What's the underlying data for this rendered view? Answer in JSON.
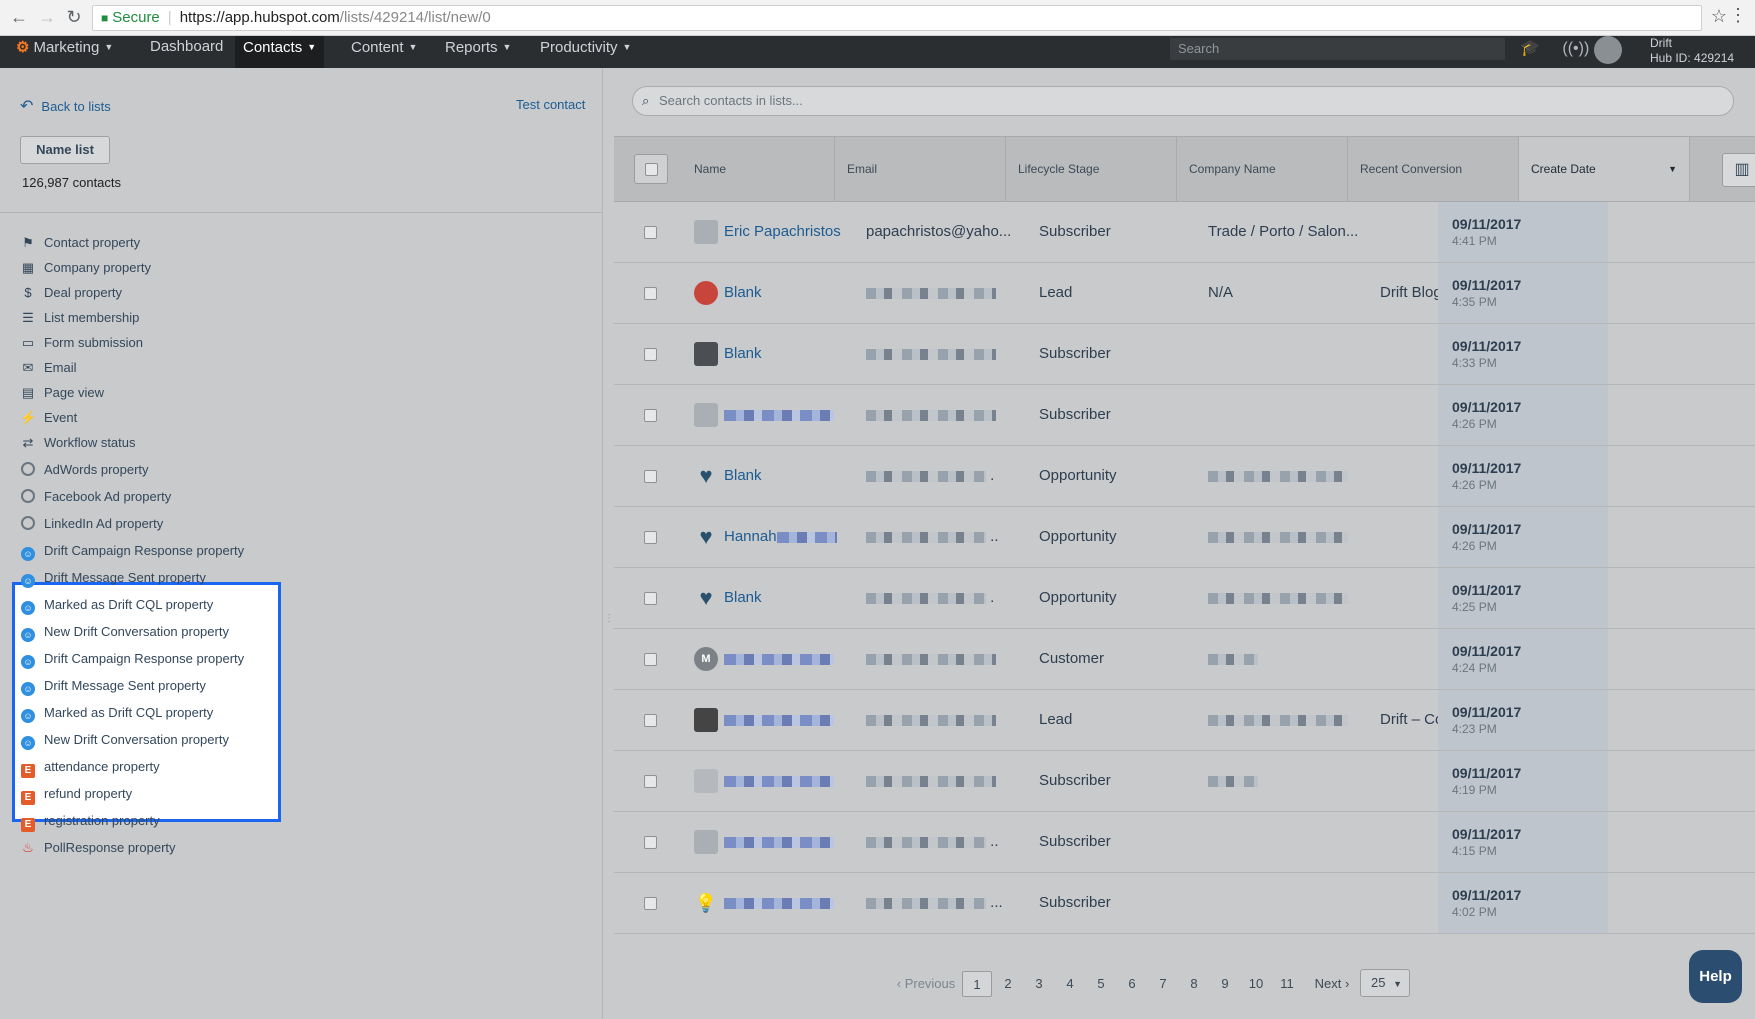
{
  "browser": {
    "back_icon": "←",
    "forward_icon": "→",
    "reload_icon": "↻",
    "secure_label": "Secure",
    "url_host": "https://app.hubspot.com",
    "url_path": "/lists/429214/list/new/0",
    "star_icon": "☆",
    "menu_icon": "⋮"
  },
  "nav": {
    "marketing": "Marketing",
    "dashboard": "Dashboard",
    "contacts": "Contacts",
    "content": "Content",
    "reports": "Reports",
    "productivity": "Productivity",
    "search_placeholder": "Search",
    "account_name": "Drift",
    "hub_id": "Hub ID: 429214"
  },
  "left": {
    "back_label": "Back to lists",
    "test_contact": "Test contact",
    "name_list_button": "Name list",
    "contacts_count": "126,987 contacts",
    "filters": [
      {
        "icon": "flag-icon",
        "glyph": "⚑",
        "label": "Contact property"
      },
      {
        "icon": "building-icon",
        "glyph": "▦",
        "label": "Company property"
      },
      {
        "icon": "dollar-icon",
        "glyph": "$",
        "label": "Deal property"
      },
      {
        "icon": "list-icon",
        "glyph": "☰",
        "label": "List membership"
      },
      {
        "icon": "form-icon",
        "glyph": "▭",
        "label": "Form submission"
      },
      {
        "icon": "envelope-icon",
        "glyph": "✉",
        "label": "Email"
      },
      {
        "icon": "page-icon",
        "glyph": "▤",
        "label": "Page view"
      },
      {
        "icon": "bolt-icon",
        "glyph": "⚡",
        "label": "Event"
      },
      {
        "icon": "shuffle-icon",
        "glyph": "⇄",
        "label": "Workflow status"
      },
      {
        "icon": "target-icon",
        "glyph": "",
        "label": "AdWords property"
      },
      {
        "icon": "target-icon",
        "glyph": "",
        "label": "Facebook Ad property"
      },
      {
        "icon": "target-icon",
        "glyph": "",
        "label": "LinkedIn Ad property"
      },
      {
        "icon": "drift-icon",
        "glyph": "☺",
        "label": "Drift Campaign Response property"
      },
      {
        "icon": "drift-icon",
        "glyph": "☺",
        "label": "Drift Message Sent property"
      },
      {
        "icon": "drift-icon",
        "glyph": "☺",
        "label": "Marked as Drift CQL property"
      },
      {
        "icon": "drift-icon",
        "glyph": "☺",
        "label": "New Drift Conversation property"
      },
      {
        "icon": "drift-icon",
        "glyph": "☺",
        "label": "Drift Campaign Response property"
      },
      {
        "icon": "drift-icon",
        "glyph": "☺",
        "label": "Drift Message Sent property"
      },
      {
        "icon": "drift-icon",
        "glyph": "☺",
        "label": "Marked as Drift CQL property"
      },
      {
        "icon": "drift-icon",
        "glyph": "☺",
        "label": "New Drift Conversation property"
      },
      {
        "icon": "eventbrite-icon",
        "glyph": "E",
        "label": "attendance property"
      },
      {
        "icon": "eventbrite-icon",
        "glyph": "E",
        "label": "refund property"
      },
      {
        "icon": "eventbrite-icon",
        "glyph": "E",
        "label": "registration property"
      },
      {
        "icon": "flame-icon",
        "glyph": "🔥",
        "label": "PollResponse property"
      }
    ]
  },
  "search": {
    "placeholder": "Search contacts in lists...",
    "icon": "search-icon"
  },
  "table": {
    "headers": [
      "Name",
      "Email",
      "Lifecycle Stage",
      "Company Name",
      "Recent Conversion",
      "Create Date"
    ],
    "rows": [
      {
        "name": "Eric Papachristos",
        "email": "papachristos@yaho...",
        "stage": "Subscriber",
        "company": "Trade / Porto / Salon...",
        "conversion": "",
        "date": "09/11/2017",
        "time": "4:41 PM",
        "avatar": "person-avatar"
      },
      {
        "name": "Blank",
        "email": "",
        "stage": "Lead",
        "company": "N/A",
        "conversion": "Drift Blog: Drift Chat",
        "date": "09/11/2017",
        "time": "4:35 PM",
        "avatar": "logo-avatar"
      },
      {
        "name": "Blank",
        "email": "",
        "stage": "Subscriber",
        "company": "",
        "conversion": "",
        "date": "09/11/2017",
        "time": "4:33 PM",
        "avatar": "briefcase-avatar"
      },
      {
        "name": "",
        "email": "",
        "stage": "Subscriber",
        "company": "",
        "conversion": "",
        "date": "09/11/2017",
        "time": "4:26 PM",
        "avatar": "person-avatar"
      },
      {
        "name": "Blank",
        "email": ".",
        "stage": "Opportunity",
        "company": "",
        "conversion": "",
        "date": "09/11/2017",
        "time": "4:26 PM",
        "avatar": "heart-avatar"
      },
      {
        "name": "Hannah",
        "email": "..",
        "stage": "Opportunity",
        "company": "",
        "conversion": "",
        "date": "09/11/2017",
        "time": "4:26 PM",
        "avatar": "heart-avatar"
      },
      {
        "name": "Blank",
        "email": ".",
        "stage": "Opportunity",
        "company": "",
        "conversion": "",
        "date": "09/11/2017",
        "time": "4:25 PM",
        "avatar": "heart-avatar"
      },
      {
        "name": "",
        "email": "",
        "stage": "Customer",
        "company": "",
        "conversion": "",
        "date": "09/11/2017",
        "time": "4:24 PM",
        "avatar": "letter-avatar"
      },
      {
        "name": "",
        "email": "",
        "stage": "Lead",
        "company": "",
        "conversion": "Drift – Conversation-...",
        "date": "09/11/2017",
        "time": "4:23 PM",
        "avatar": "photo-avatar"
      },
      {
        "name": "",
        "email": "",
        "stage": "Subscriber",
        "company": "",
        "conversion": "",
        "date": "09/11/2017",
        "time": "4:19 PM",
        "avatar": "doc-avatar"
      },
      {
        "name": "",
        "email": "..",
        "stage": "Subscriber",
        "company": "",
        "conversion": "",
        "date": "09/11/2017",
        "time": "4:15 PM",
        "avatar": "person-avatar"
      },
      {
        "name": "",
        "email": "...",
        "stage": "Subscriber",
        "company": "",
        "conversion": "",
        "date": "09/11/2017",
        "time": "4:02 PM",
        "avatar": "bulb-avatar"
      }
    ]
  },
  "pager": {
    "prev": "Previous",
    "pages": [
      "1",
      "2",
      "3",
      "4",
      "5",
      "6",
      "7",
      "8",
      "9",
      "10",
      "11"
    ],
    "next": "Next",
    "per_page": "25"
  },
  "help": "Help"
}
